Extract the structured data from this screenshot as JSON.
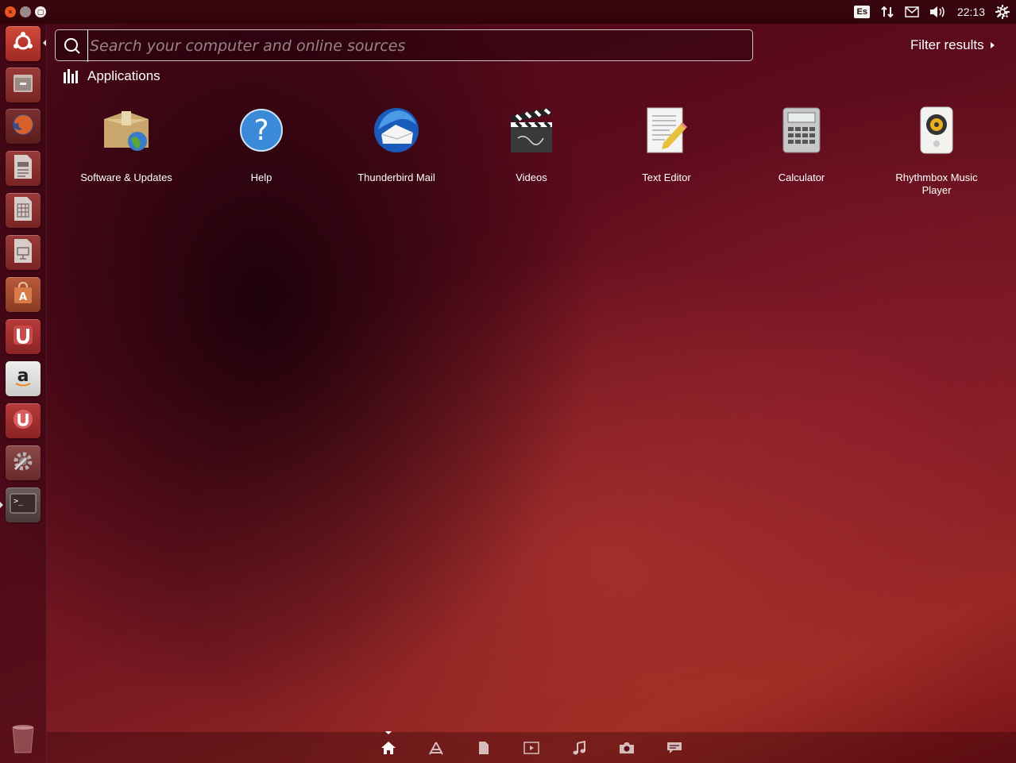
{
  "top_panel": {
    "keyboard_layout": "Es",
    "clock": "22:13",
    "icons": [
      "network-icon",
      "mail-icon",
      "volume-icon",
      "settings-gear-icon"
    ]
  },
  "launcher": {
    "items": [
      {
        "name": "dash-home",
        "icon": "ubuntu-logo-icon"
      },
      {
        "name": "files",
        "icon": "file-cabinet-icon"
      },
      {
        "name": "firefox",
        "icon": "firefox-icon"
      },
      {
        "name": "writer",
        "icon": "document-icon"
      },
      {
        "name": "calc",
        "icon": "spreadsheet-icon"
      },
      {
        "name": "impress",
        "icon": "presentation-icon"
      },
      {
        "name": "software-center",
        "icon": "shopping-bag-icon"
      },
      {
        "name": "ubuntu-one",
        "icon": "ubuntu-one-icon"
      },
      {
        "name": "amazon",
        "icon": "amazon-icon"
      },
      {
        "name": "ubuntu-one-music",
        "icon": "ubuntu-one-music-icon"
      },
      {
        "name": "system-settings",
        "icon": "settings-icon"
      },
      {
        "name": "terminal",
        "icon": "terminal-icon"
      }
    ],
    "trash_icon": "trash-icon"
  },
  "dash": {
    "search_placeholder": "Search your computer and online sources",
    "filter_label": "Filter results",
    "section_title": "Applications",
    "apps": [
      {
        "label": "Software & Updates",
        "icon": "software-updates-icon"
      },
      {
        "label": "Help",
        "icon": "help-icon"
      },
      {
        "label": "Thunderbird Mail",
        "icon": "thunderbird-icon"
      },
      {
        "label": "Videos",
        "icon": "clapperboard-icon"
      },
      {
        "label": "Text Editor",
        "icon": "text-editor-icon"
      },
      {
        "label": "Calculator",
        "icon": "calculator-icon"
      },
      {
        "label": "Rhythmbox Music Player",
        "icon": "speaker-icon"
      }
    ]
  },
  "lenses": [
    {
      "name": "home",
      "icon": "home-icon",
      "active": true
    },
    {
      "name": "applications",
      "icon": "applications-icon"
    },
    {
      "name": "files",
      "icon": "file-icon"
    },
    {
      "name": "video",
      "icon": "video-icon"
    },
    {
      "name": "music",
      "icon": "music-icon"
    },
    {
      "name": "photos",
      "icon": "camera-icon"
    },
    {
      "name": "social",
      "icon": "chat-icon"
    }
  ],
  "colors": {
    "panel": "#300409",
    "accent": "#e9541f"
  }
}
